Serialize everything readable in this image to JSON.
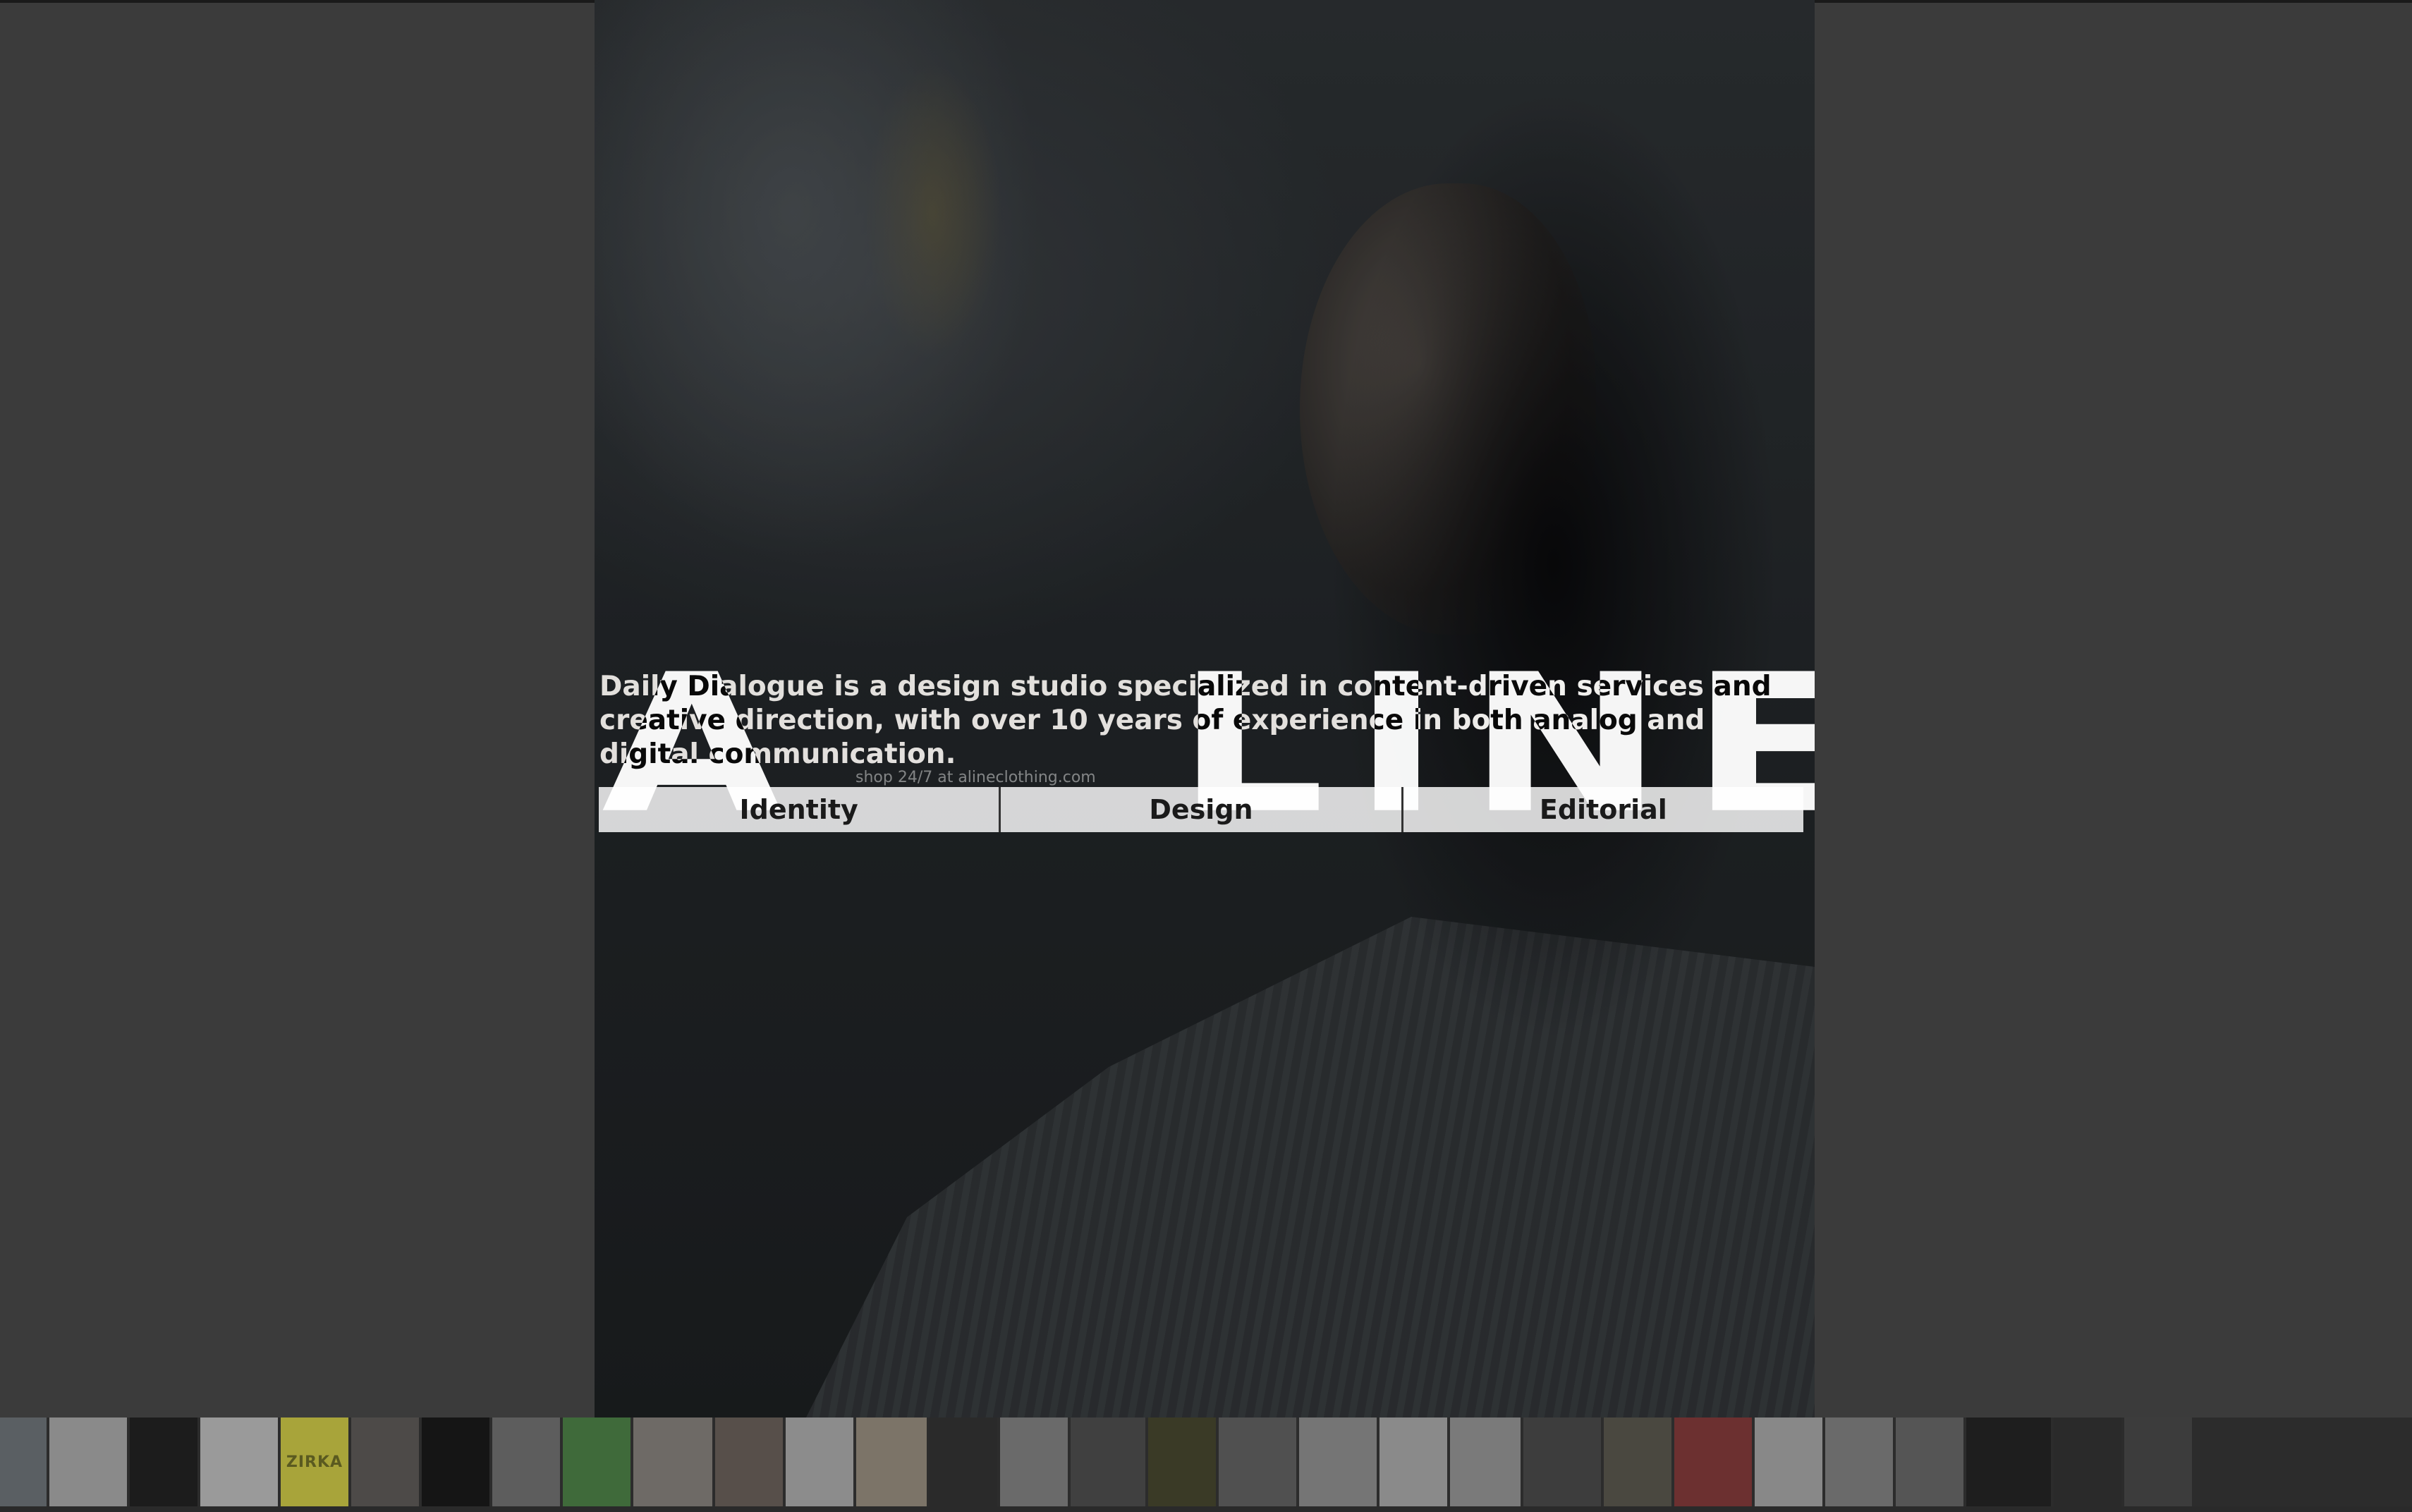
{
  "hero": {
    "big_word_left": "A",
    "big_word_right": "LINE",
    "shop_text": "shop 24/7 at alineclothing.com"
  },
  "intro": {
    "text": "Daily Dialogue is a design studio specialized in content-driven services and creative direction, with over 10 years of experience in both analog and digital communication."
  },
  "categories": [
    {
      "label": "Identity"
    },
    {
      "label": "Design"
    },
    {
      "label": "Editorial"
    }
  ],
  "thumbnails": [
    {
      "name": "project-thumb-01",
      "color": "#5a5f63"
    },
    {
      "name": "project-thumb-02",
      "color": "#8a8a8a"
    },
    {
      "name": "project-thumb-03",
      "color": "#1c1c1c"
    },
    {
      "name": "project-thumb-04",
      "color": "#9a9a9a"
    },
    {
      "name": "project-thumb-05",
      "color": "#a8a43a",
      "label": "ZIRKA"
    },
    {
      "name": "project-thumb-06",
      "color": "#4d4a48"
    },
    {
      "name": "project-thumb-07",
      "color": "#151515"
    },
    {
      "name": "project-thumb-08",
      "color": "#5d5d5d"
    },
    {
      "name": "project-thumb-09",
      "color": "#3f6a3a"
    },
    {
      "name": "project-thumb-10",
      "color": "#6e6a66"
    },
    {
      "name": "project-thumb-11",
      "color": "#574f4a"
    },
    {
      "name": "project-thumb-12",
      "color": "#8c8c8c"
    },
    {
      "name": "project-thumb-13",
      "color": "#7c7468"
    },
    {
      "name": "project-thumb-14",
      "color": "#2a2a2a"
    },
    {
      "name": "project-thumb-15",
      "color": "#6a6a6a"
    },
    {
      "name": "project-thumb-16",
      "color": "#404040"
    },
    {
      "name": "project-thumb-17",
      "color": "#3a3a26"
    },
    {
      "name": "project-thumb-18",
      "color": "#505050"
    },
    {
      "name": "project-thumb-19",
      "color": "#757575"
    },
    {
      "name": "project-thumb-20",
      "color": "#8a8a8a"
    },
    {
      "name": "project-thumb-21",
      "color": "#7a7a7a"
    },
    {
      "name": "project-thumb-22",
      "color": "#3d3d3d"
    },
    {
      "name": "project-thumb-23",
      "color": "#4a4840"
    },
    {
      "name": "project-thumb-24",
      "color": "#6c3030"
    },
    {
      "name": "project-thumb-25",
      "color": "#888888"
    },
    {
      "name": "project-thumb-26",
      "color": "#6a6a6a"
    },
    {
      "name": "project-thumb-27",
      "color": "#555555"
    },
    {
      "name": "project-thumb-28",
      "color": "#1e1e1e"
    },
    {
      "name": "project-thumb-29",
      "color": "#2a2a2a"
    },
    {
      "name": "project-thumb-30",
      "color": "#3c3c3c"
    }
  ]
}
